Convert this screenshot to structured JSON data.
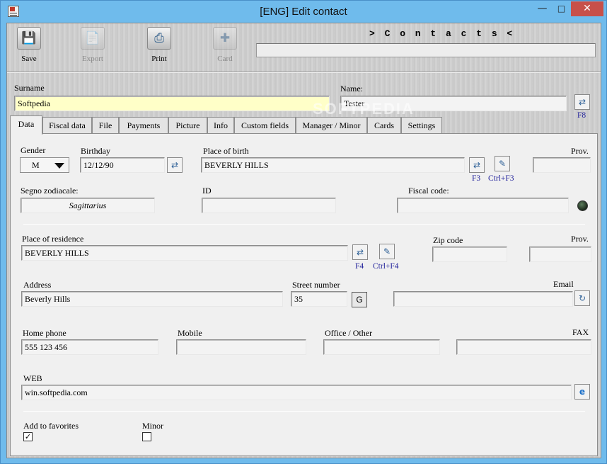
{
  "window": {
    "title": "[ENG] Edit contact"
  },
  "toolbar": {
    "save": "Save",
    "export": "Export",
    "print": "Print",
    "card": "Card",
    "section_label": "> C o n t a c t s <"
  },
  "header": {
    "surname_label": "Surname",
    "surname": "Softpedia",
    "name_label": "Name:",
    "name": "Tester",
    "name_key": "F8"
  },
  "tabs": [
    "Data",
    "Fiscal data",
    "File",
    "Payments",
    "Picture",
    "Info",
    "Custom fields",
    "Manager / Minor",
    "Cards",
    "Settings"
  ],
  "data": {
    "gender_label": "Gender",
    "gender": "M",
    "birthday_label": "Birthday",
    "birthday": "12/12/90",
    "place_of_birth_label": "Place of birth",
    "place_of_birth": "BEVERLY HILLS",
    "birth_key1": "F3",
    "birth_key2": "Ctrl+F3",
    "prov_label": "Prov.",
    "zodiac_label": "Segno zodiacale:",
    "zodiac": "Sagittarius",
    "id_label": "ID",
    "fiscal_label": "Fiscal code:",
    "residence_label": "Place of residence",
    "residence": "BEVERLY HILLS",
    "res_key1": "F4",
    "res_key2": "Ctrl+F4",
    "zip_label": "Zip code",
    "prov2_label": "Prov.",
    "address_label": "Address",
    "address": "Beverly Hills",
    "street_number_label": "Street number",
    "street_number": "35",
    "g_button": "G",
    "email_label": "Email",
    "home_phone_label": "Home phone",
    "home_phone": "555 123 456",
    "mobile_label": "Mobile",
    "office_label": "Office / Other",
    "fax_label": "FAX",
    "web_label": "WEB",
    "web": "win.softpedia.com",
    "favorites_label": "Add to favorites",
    "favorites_checked": true,
    "minor_label": "Minor",
    "minor_checked": false
  },
  "watermark": "SOFTPEDIA"
}
